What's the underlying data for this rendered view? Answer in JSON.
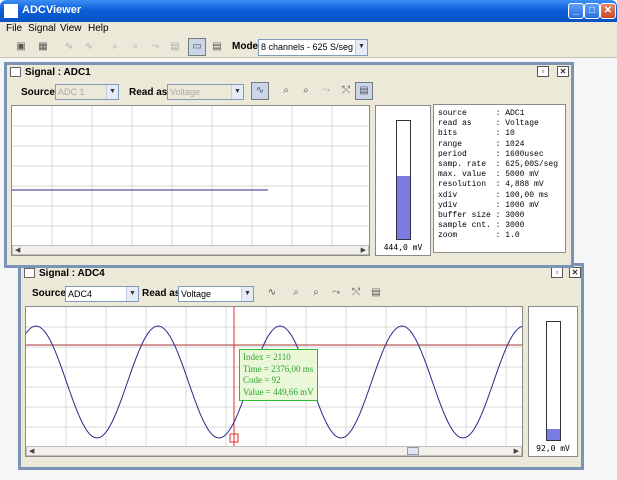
{
  "app": {
    "title": "ADCViewer"
  },
  "window_controls": {
    "minimize": "_",
    "maximize": "□",
    "close": "✕"
  },
  "menu": {
    "items": [
      "File",
      "Signal",
      "View",
      "Help"
    ]
  },
  "toolbar": {
    "mode_label": "Mode:",
    "mode_value": "8 channels - 625 S/seg"
  },
  "windows": [
    {
      "title": "Signal : ADC1",
      "source_label": "Source:",
      "source_value": "ADC 1",
      "read_as_label": "Read as:",
      "read_as_value": "Voltage",
      "meter_value": "444,0 mV",
      "meter_level": 0.444,
      "info": [
        {
          "key": "source",
          "value": "ADC1"
        },
        {
          "key": "read as",
          "value": "Voltage"
        },
        {
          "key": "bits",
          "value": "10"
        },
        {
          "key": "range",
          "value": "1024"
        },
        {
          "key": "period",
          "value": "1600usec"
        },
        {
          "key": "samp. rate",
          "value": "625,00S/seg"
        },
        {
          "key": "max. value",
          "value": "5000 mV"
        },
        {
          "key": "resolution",
          "value": "4,888 mV"
        },
        {
          "key": "xdiv",
          "value": "100,00 ms"
        },
        {
          "key": "ydiv",
          "value": "1000 mV"
        },
        {
          "key": "buffer size",
          "value": "3000"
        },
        {
          "key": "sample cnt.",
          "value": "3000"
        },
        {
          "key": "zoom",
          "value": "1.0"
        }
      ]
    },
    {
      "title": "Signal : ADC4",
      "source_label": "Source:",
      "source_value": "ADC4",
      "read_as_label": "Read as:",
      "read_as_value": "Voltage",
      "meter_value": "92,0 mV",
      "meter_level": 0.092,
      "tooltip": {
        "index": "Index = 2110",
        "time": "Time = 2376,00 ms",
        "code": "Code = 92",
        "value": "Value = 449,66 mV"
      }
    }
  ],
  "colors": {
    "accent": "#0a5ed8",
    "signal": "#2b2b8a",
    "cursor": "#e03030",
    "tooltip": "#2cbf2c",
    "meter": "#7b7be6"
  },
  "icons": [
    "chart-icon",
    "settings-icon",
    "signal-icon",
    "zoom-in-icon",
    "zoom-out-icon",
    "zoom-reset-icon",
    "fit-icon",
    "table-icon",
    "layout-icon"
  ]
}
